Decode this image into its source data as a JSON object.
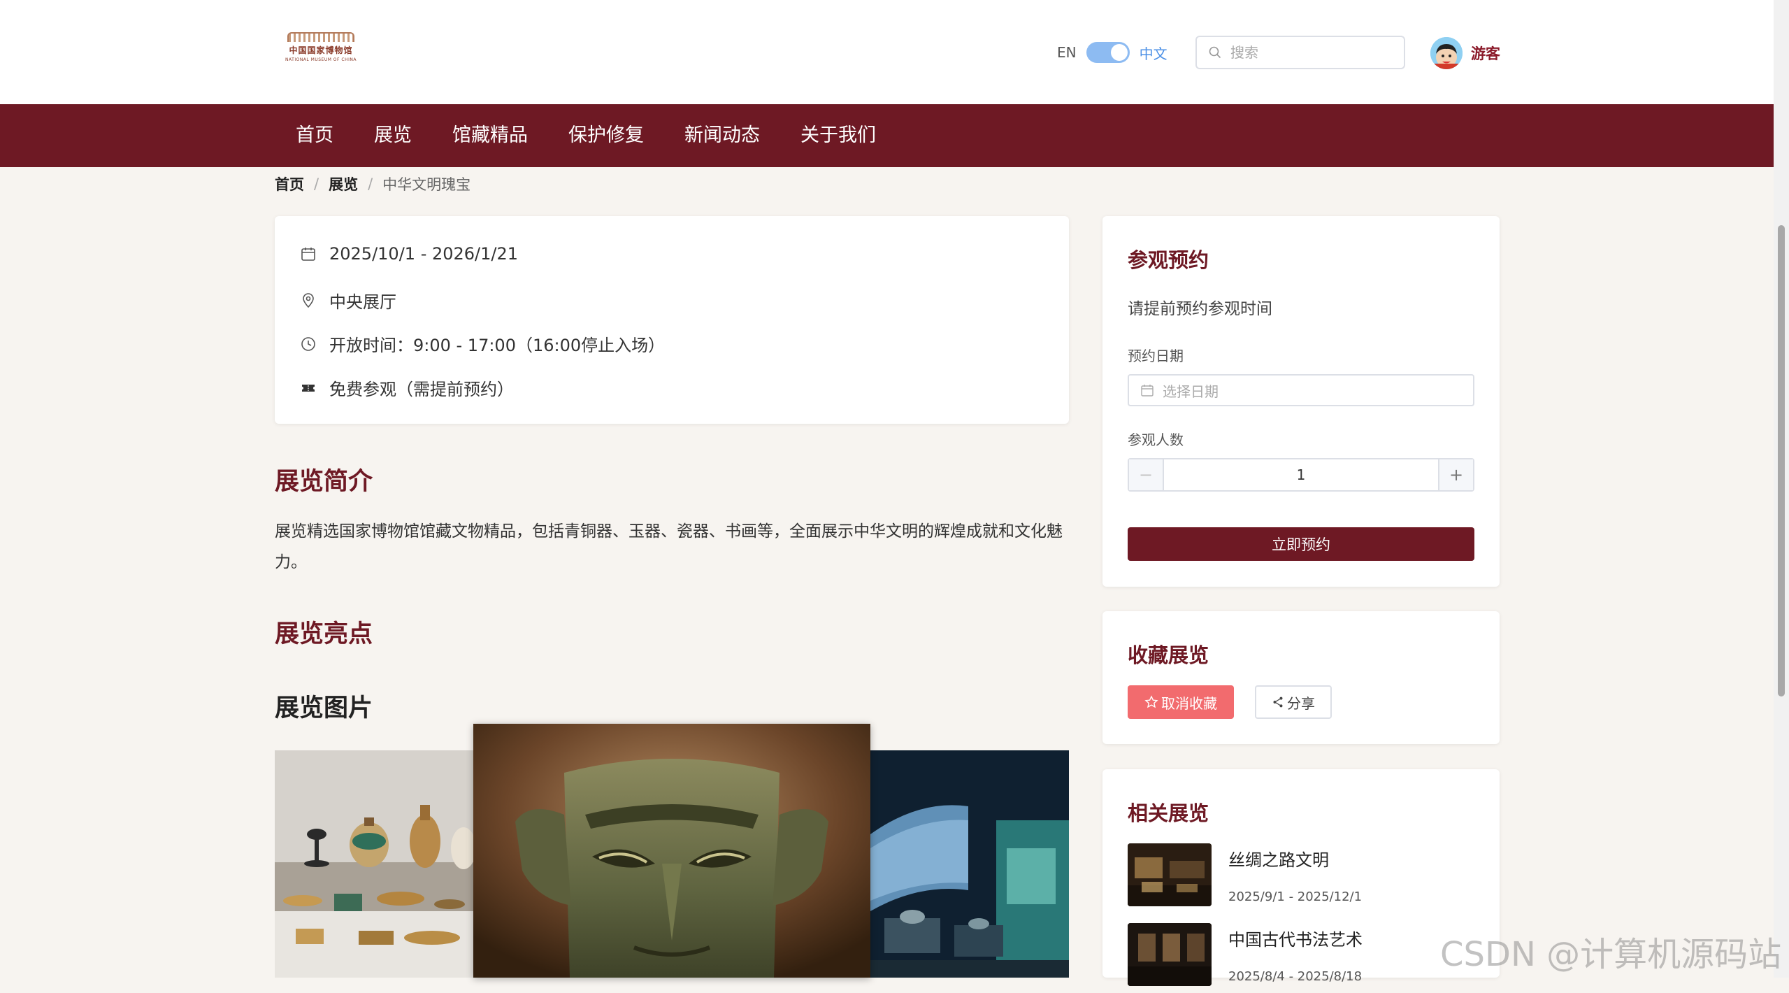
{
  "header": {
    "logo_cn": "中国国家博物馆",
    "logo_en": "NATIONAL MUSEUM OF CHINA",
    "lang_en": "EN",
    "lang_zh": "中文",
    "search_placeholder": "搜索",
    "username": "游客"
  },
  "nav": {
    "items": [
      {
        "label": "首页"
      },
      {
        "label": "展览"
      },
      {
        "label": "馆藏精品"
      },
      {
        "label": "保护修复"
      },
      {
        "label": "新闻动态"
      },
      {
        "label": "关于我们"
      }
    ]
  },
  "breadcrumb": {
    "home": "首页",
    "sep": "/",
    "exhibitions": "展览",
    "current": "中华文明瑰宝"
  },
  "info": {
    "dates": "2025/10/1 - 2026/1/21",
    "location": "中央展厅",
    "hours": "开放时间：9:00 - 17:00（16:00停止入场）",
    "ticket": "免费参观（需提前预约）"
  },
  "intro": {
    "title": "展览简介",
    "text": "展览精选国家博物馆馆藏文物精品，包括青铜器、玉器、瓷器、书画等，全面展示中华文明的辉煌成就和文化魅力。"
  },
  "highlights": {
    "title": "展览亮点"
  },
  "pictures": {
    "title": "展览图片"
  },
  "booking": {
    "title": "参观预约",
    "subtitle": "请提前预约参观时间",
    "date_label": "预约日期",
    "date_placeholder": "选择日期",
    "count_label": "参观人数",
    "count_value": "1",
    "minus": "−",
    "plus": "+",
    "submit": "立即预约"
  },
  "favorite": {
    "title": "收藏展览",
    "unfavorite": "取消收藏",
    "share": "分享"
  },
  "related": {
    "title": "相关展览",
    "items": [
      {
        "title": "丝绸之路文明",
        "date": "2025/9/1 - 2025/12/1"
      },
      {
        "title": "中国古代书法艺术",
        "date": "2025/8/4 - 2025/8/18"
      }
    ]
  },
  "watermark": "CSDN @计算机源码站",
  "colors": {
    "brand": "#6e1924",
    "danger": "#f26b6e",
    "toggle": "#8dbbf2"
  }
}
